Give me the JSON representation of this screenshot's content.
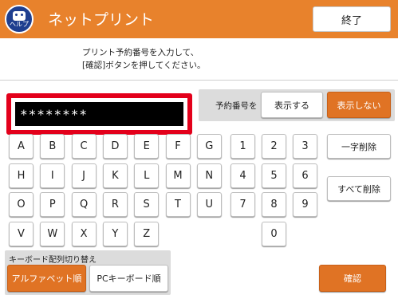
{
  "header": {
    "help_label": "ヘルプ",
    "title": "ネットプリント",
    "end_label": "終了"
  },
  "instructions": [
    "プリント予約番号を入力して、",
    "[確認]ボタンを押してください。"
  ],
  "input": {
    "masked_value": "********"
  },
  "display_toggle": {
    "label": "予約番号を",
    "show_label": "表示する",
    "hide_label": "表示しない",
    "selected": "表示しない"
  },
  "keys": {
    "letters": [
      "A",
      "B",
      "C",
      "D",
      "E",
      "F",
      "G",
      "H",
      "I",
      "J",
      "K",
      "L",
      "M",
      "N",
      "O",
      "P",
      "Q",
      "R",
      "S",
      "T",
      "U",
      "V",
      "W",
      "X",
      "Y",
      "Z"
    ],
    "digits": [
      "1",
      "2",
      "3",
      "4",
      "5",
      "6",
      "7",
      "8",
      "9",
      "0"
    ]
  },
  "actions": {
    "delete_one": "一字削除",
    "delete_all": "すべて削除",
    "confirm": "確認"
  },
  "keyboard_switch": {
    "label": "キーボード配列切り替え",
    "alphabet": "アルファベット順",
    "pc": "PCキーボード順",
    "selected": "アルファベット順"
  },
  "colors": {
    "header": "#e8822c",
    "accent": "#e07324",
    "highlight_border": "#e3001b",
    "help_icon": "#1f3f8f"
  }
}
